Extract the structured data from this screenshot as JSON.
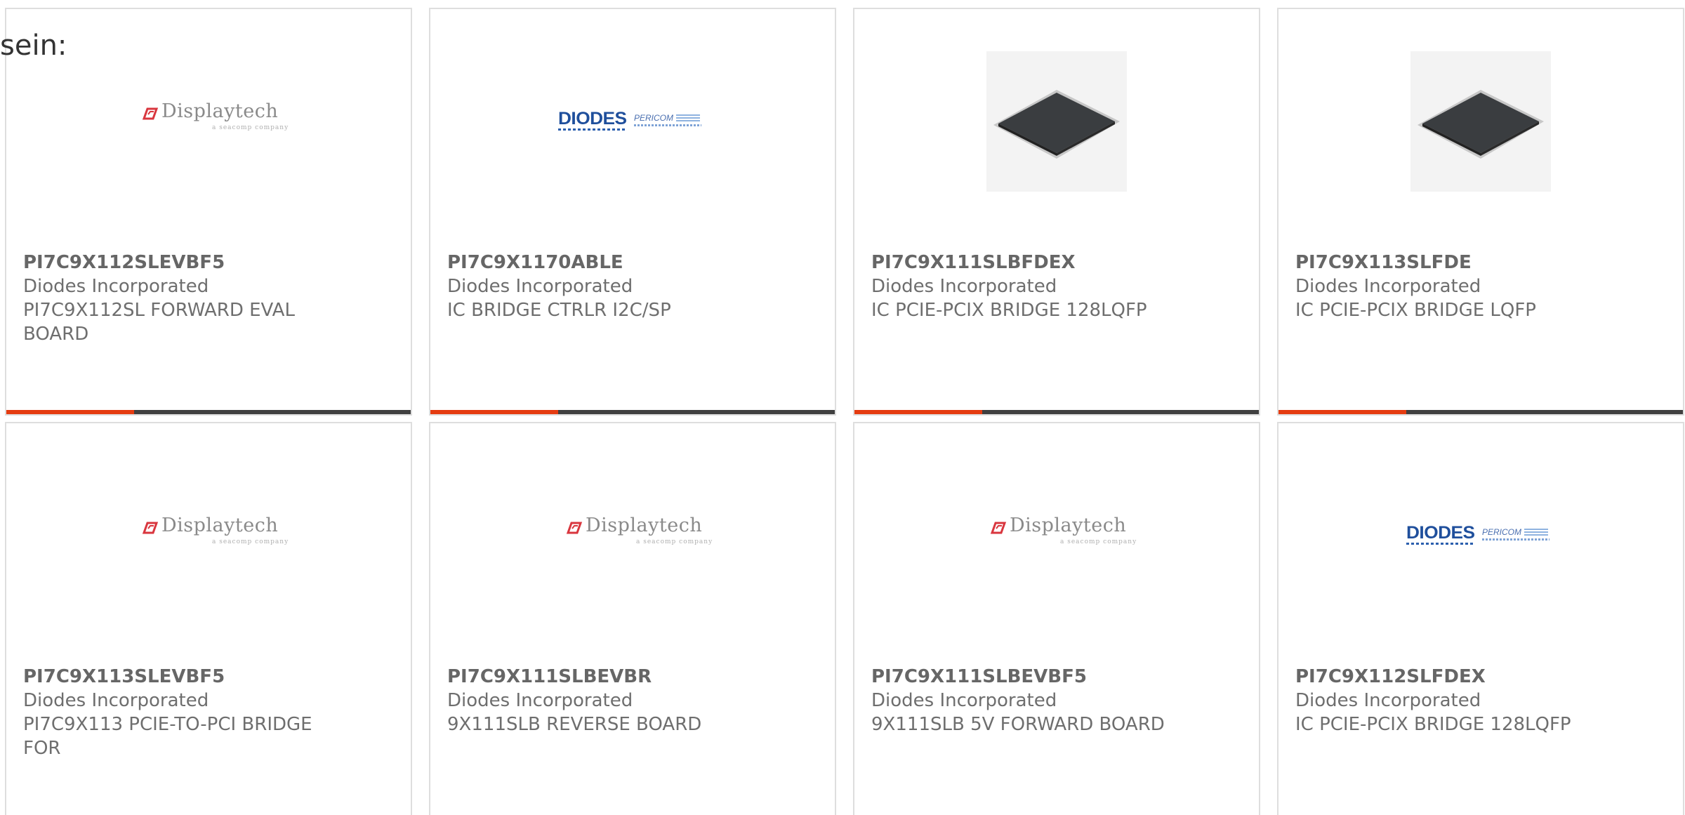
{
  "lead_text": "sein:",
  "colors": {
    "accent": "#e53c11",
    "bar": "#404040",
    "border": "#dedede",
    "text": "#6e6e6e"
  },
  "products": [
    {
      "part_number": "PI7C9X112SLEVBF5",
      "manufacturer": "Diodes Incorporated",
      "description": "PI7C9X112SL FORWARD EVAL BOARD",
      "image": "displaytech-logo",
      "logo_text": "Displaytech",
      "logo_tagline": "a seacomp company"
    },
    {
      "part_number": "PI7C9X1170ABLE",
      "manufacturer": "Diodes Incorporated",
      "description": "IC BRIDGE CTRLR I2C/SP",
      "image": "diodes-pericom-logo",
      "logo_text": "DIODES",
      "logo_text_2": "PERICOM"
    },
    {
      "part_number": "PI7C9X111SLBFDEX",
      "manufacturer": "Diodes Incorporated",
      "description": "IC PCIE-PCIX BRIDGE 128LQFP",
      "image": "lqfp-chip-photo"
    },
    {
      "part_number": "PI7C9X113SLFDE",
      "manufacturer": "Diodes Incorporated",
      "description": "IC PCIE-PCIX BRIDGE LQFP",
      "image": "lqfp-chip-photo"
    },
    {
      "part_number": "PI7C9X113SLEVBF5",
      "manufacturer": "Diodes Incorporated",
      "description": "PI7C9X113 PCIE-TO-PCI BRIDGE FOR",
      "image": "displaytech-logo",
      "logo_text": "Displaytech",
      "logo_tagline": "a seacomp company"
    },
    {
      "part_number": "PI7C9X111SLBEVBR",
      "manufacturer": "Diodes Incorporated",
      "description": "9X111SLB REVERSE BOARD",
      "image": "displaytech-logo",
      "logo_text": "Displaytech",
      "logo_tagline": "a seacomp company"
    },
    {
      "part_number": "PI7C9X111SLBEVBF5",
      "manufacturer": "Diodes Incorporated",
      "description": "9X111SLB 5V FORWARD BOARD",
      "image": "displaytech-logo",
      "logo_text": "Displaytech",
      "logo_tagline": "a seacomp company"
    },
    {
      "part_number": "PI7C9X112SLFDEX",
      "manufacturer": "Diodes Incorporated",
      "description": "IC PCIE-PCIX BRIDGE 128LQFP",
      "image": "diodes-pericom-logo",
      "logo_text": "DIODES",
      "logo_text_2": "PERICOM"
    }
  ]
}
